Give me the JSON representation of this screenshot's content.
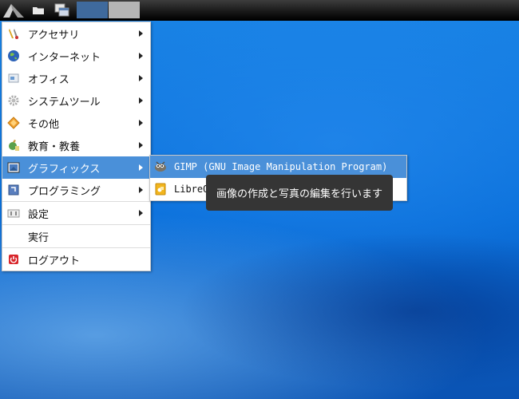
{
  "taskbar": {
    "start_icon": "start-menu-icon",
    "files_icon": "folder-icon",
    "windows_icon": "windows-icon",
    "desktops": [
      "desktop-1",
      "desktop-2"
    ]
  },
  "menu": {
    "items": [
      {
        "label": "アクセサリ",
        "icon": "accessories-icon",
        "submenu": true
      },
      {
        "label": "インターネット",
        "icon": "internet-icon",
        "submenu": true
      },
      {
        "label": "オフィス",
        "icon": "office-icon",
        "submenu": true
      },
      {
        "label": "システムツール",
        "icon": "system-tools-icon",
        "submenu": true
      },
      {
        "label": "その他",
        "icon": "other-icon",
        "submenu": true
      },
      {
        "label": "教育・教養",
        "icon": "education-icon",
        "submenu": true
      },
      {
        "label": "グラフィックス",
        "icon": "graphics-icon",
        "submenu": true,
        "active": true
      },
      {
        "label": "プログラミング",
        "icon": "programming-icon",
        "submenu": true
      },
      {
        "label": "設定",
        "icon": "settings-icon",
        "submenu": true
      },
      {
        "label": "実行",
        "icon": "",
        "submenu": false
      },
      {
        "label": "ログアウト",
        "icon": "logout-icon",
        "submenu": false
      }
    ]
  },
  "submenu": {
    "items": [
      {
        "label": "GIMP (GNU Image Manipulation Program)",
        "icon": "gimp-icon",
        "active": true
      },
      {
        "label": "LibreOffice Draw",
        "icon": "libreoffice-draw-icon"
      }
    ]
  },
  "tooltip": {
    "text": "画像の作成と写真の編集を行います"
  },
  "colors": {
    "highlight": "#4a90d9",
    "tooltip_bg": "#353535",
    "desktop_blue": "#0a6fda"
  }
}
